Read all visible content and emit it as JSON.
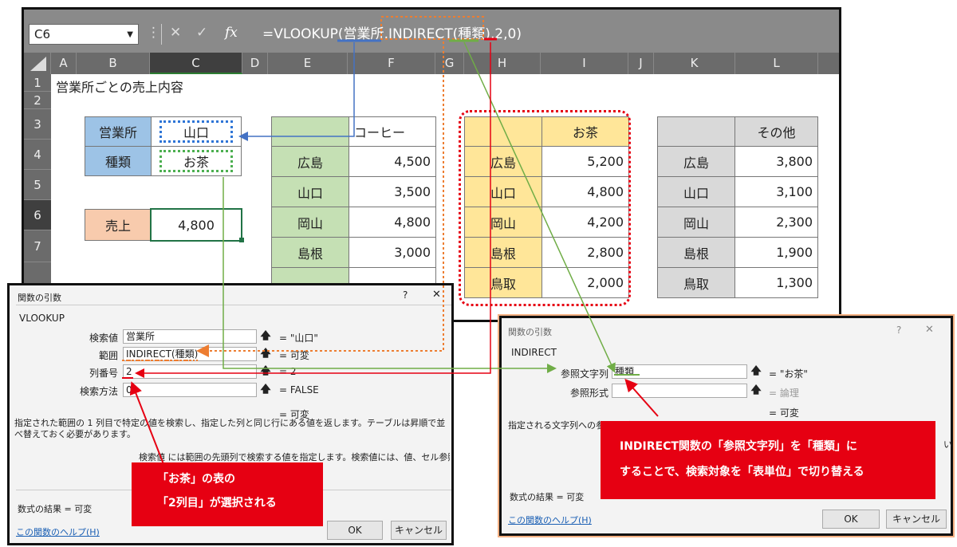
{
  "excel": {
    "name_box": "C6",
    "fx_label": "fx",
    "formula": {
      "prefix": "=VLOOKUP(",
      "arg1": "営業所",
      "sep1": ",",
      "arg2": "INDIRECT(種類)",
      "sep2": ",",
      "arg3": "2",
      "suffix": ",0)"
    },
    "columns": [
      "A",
      "B",
      "C",
      "D",
      "E",
      "F",
      "G",
      "H",
      "I",
      "J",
      "K",
      "L"
    ],
    "rows": [
      "1",
      "2",
      "3",
      "4",
      "5",
      "6",
      "7"
    ],
    "title": "営業所ごとの売上内容",
    "lookup": {
      "office_label": "営業所",
      "office_value": "山口",
      "kind_label": "種類",
      "kind_value": "お茶",
      "sales_label": "売上",
      "sales_value": "4,800"
    },
    "tables": [
      {
        "header": "コーヒー",
        "rows": [
          [
            "広島",
            "4,500"
          ],
          [
            "山口",
            "3,500"
          ],
          [
            "岡山",
            "4,800"
          ],
          [
            "島根",
            "3,000"
          ]
        ]
      },
      {
        "header": "お茶",
        "rows": [
          [
            "広島",
            "5,200"
          ],
          [
            "山口",
            "4,800"
          ],
          [
            "岡山",
            "4,200"
          ],
          [
            "島根",
            "2,800"
          ],
          [
            "鳥取",
            "2,000"
          ]
        ]
      },
      {
        "header": "その他",
        "rows": [
          [
            "広島",
            "3,800"
          ],
          [
            "山口",
            "3,100"
          ],
          [
            "岡山",
            "2,300"
          ],
          [
            "島根",
            "1,900"
          ],
          [
            "鳥取",
            "1,300"
          ]
        ]
      }
    ]
  },
  "dialog_left": {
    "title": "関数の引数",
    "help_mark": "?",
    "close": "✕",
    "func": "VLOOKUP",
    "args": [
      {
        "label": "検索値",
        "value": "営業所",
        "result": "= \"山口\""
      },
      {
        "label": "範囲",
        "value": "INDIRECT(種類)",
        "result": "= 可変"
      },
      {
        "label": "列番号",
        "value": "2",
        "result": "= 2"
      },
      {
        "label": "検索方法",
        "value": "0",
        "result": "= FALSE"
      }
    ],
    "total_result": "= 可変",
    "description": "指定された範囲の 1 列目で特定の値を検索し、指定した列と同じ行にある値を返します。テーブルは昇順で並べ替えておく必要があります。",
    "arg_help": "検索値  には範囲の先頭列で検索する値を指定します。検索値には、値、セル参照、または",
    "formula_result": "数式の結果 =   可変",
    "help_link": "この関数のヘルプ(H)",
    "ok": "OK",
    "cancel": "キャンセル"
  },
  "dialog_right": {
    "title": "関数の引数",
    "help_mark": "?",
    "close": "✕",
    "func": "INDIRECT",
    "args": [
      {
        "label": "参照文字列",
        "value": "種類",
        "result": "= \"お茶\""
      },
      {
        "label": "参照形式",
        "value": "",
        "result": "= 論理"
      }
    ],
    "total_result": "= 可変",
    "description": "指定される文字列への参照を返します。",
    "edge_text": "い",
    "formula_result": "数式の結果 =   可変",
    "help_link": "この関数のヘルプ(H)",
    "ok": "OK",
    "cancel": "キャンセル"
  },
  "callouts": {
    "left": [
      "「お茶」の表の",
      "「2列目」が選択される"
    ],
    "right": [
      "INDIRECT関数の「参照文字列」を「種類」に",
      "することで、検索対象を「表単位」で切り替える"
    ]
  },
  "colors": {
    "blue": "#9dc3e6",
    "green": "#c5e0b4",
    "yellow": "#ffe699",
    "gray": "#d9d9d9",
    "salmon": "#f8cbad",
    "red": "#e60012",
    "orange": "#ed7d31"
  }
}
